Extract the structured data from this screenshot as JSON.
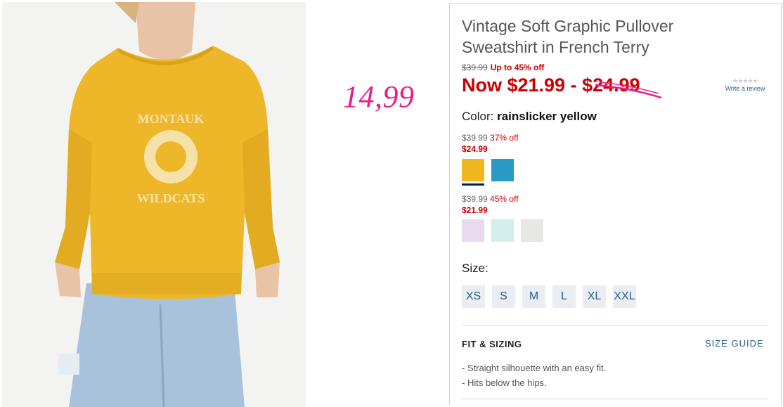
{
  "annotation": {
    "text": "14,99",
    "color": "#e91e8c"
  },
  "product": {
    "title": "Vintage Soft Graphic Pullover Sweatshirt in French Terry",
    "original_price": "$39.99",
    "discount_text": "Up to 45% off",
    "now_prefix": "Now $21.99 - ",
    "now_high": "$24.99",
    "rating": {
      "stars": "★★★★★",
      "write_review": "Write a review"
    },
    "color_label": "Color:",
    "color_value": "rainslicker yellow",
    "price_groups": [
      {
        "original": "$39.99",
        "percent": "37% off",
        "sale": "$24.99",
        "swatches": [
          {
            "name": "yellow",
            "hex": "#f0b81e",
            "selected": true
          },
          {
            "name": "blue",
            "hex": "#2999c6",
            "selected": false
          }
        ]
      },
      {
        "original": "$39.99",
        "percent": "45% off",
        "sale": "$21.99",
        "swatches": [
          {
            "name": "lavender",
            "hex": "#e7dced",
            "selected": false
          },
          {
            "name": "mint",
            "hex": "#d3eeeb",
            "selected": false
          },
          {
            "name": "light-gray",
            "hex": "#e7e8e5",
            "selected": false
          }
        ]
      }
    ],
    "size_label": "Size:",
    "sizes": [
      "XS",
      "S",
      "M",
      "L",
      "XL",
      "XXL"
    ],
    "fit": {
      "title": "FIT & SIZING",
      "size_guide": "SIZE GUIDE",
      "bullets": [
        "- Straight silhouette with an easy fit.",
        "- Hits below the hips."
      ]
    }
  },
  "colors": {
    "sale_red": "#cc0000",
    "link_blue": "#225d8c",
    "accent_pink": "#e91e8c"
  }
}
